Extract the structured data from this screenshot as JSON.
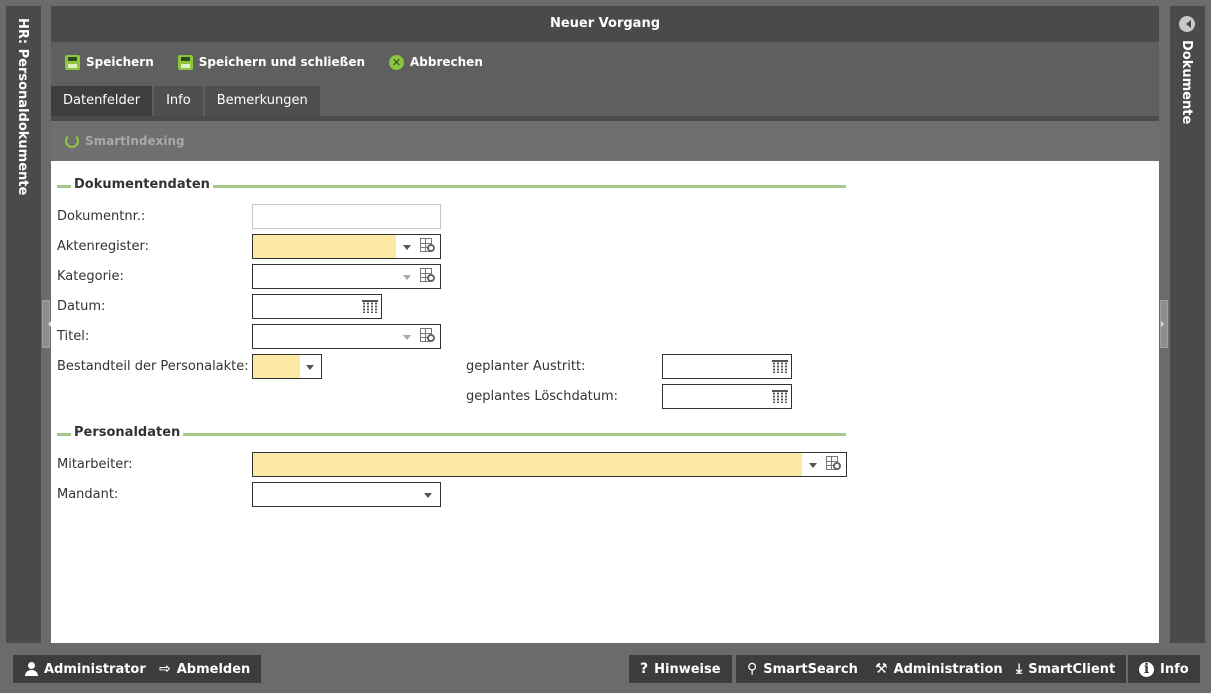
{
  "left_panel": {
    "title": "HR: Personaldokumente"
  },
  "right_panel": {
    "title": "Dokumente"
  },
  "window": {
    "title": "Neuer Vorgang"
  },
  "toolbar": {
    "save_label": "Speichern",
    "save_close_label": "Speichern und schließen",
    "cancel_label": "Abbrechen"
  },
  "tabs": [
    {
      "label": "Datenfelder",
      "active": true
    },
    {
      "label": "Info",
      "active": false
    },
    {
      "label": "Bemerkungen",
      "active": false
    }
  ],
  "subbar": {
    "smartindexing_label": "SmartIndexing"
  },
  "sections": {
    "document": {
      "title": "Dokumentendaten",
      "fields": {
        "dokumentnr": {
          "label": "Dokumentnr.:",
          "value": ""
        },
        "aktenregister": {
          "label": "Aktenregister:",
          "value": ""
        },
        "kategorie": {
          "label": "Kategorie:",
          "value": ""
        },
        "datum": {
          "label": "Datum:",
          "value": ""
        },
        "titel": {
          "label": "Titel:",
          "value": ""
        },
        "bestandteil": {
          "label": "Bestandteil der Personalakte:",
          "value": ""
        },
        "austritt": {
          "label": "geplanter Austritt:",
          "value": ""
        },
        "loeschdatum": {
          "label": "geplantes Löschdatum:",
          "value": ""
        }
      }
    },
    "personal": {
      "title": "Personaldaten",
      "fields": {
        "mitarbeiter": {
          "label": "Mitarbeiter:",
          "value": ""
        },
        "mandant": {
          "label": "Mandant:",
          "value": ""
        }
      }
    }
  },
  "bottom_bar": {
    "administrator": "Administrator",
    "abmelden": "Abmelden",
    "hinweise": "Hinweise",
    "smartsearch": "SmartSearch",
    "administration": "Administration",
    "smartclient": "SmartClient",
    "info": "Info"
  },
  "colors": {
    "accent_green": "#8cc63f",
    "required_field": "#fde9a6",
    "section_line": "#a6c98a"
  }
}
